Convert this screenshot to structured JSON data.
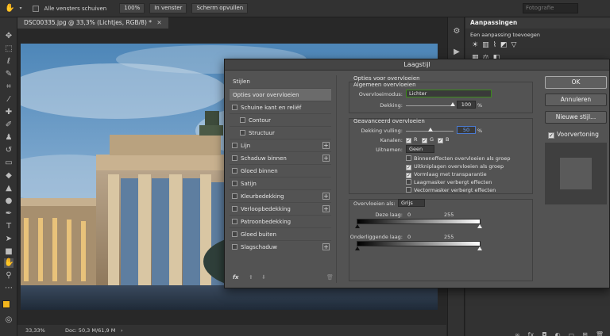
{
  "optbar": {
    "scroll_all": "Alle vensters schuiven",
    "zoom": "100%",
    "fit_window": "In venster",
    "fill_screen": "Scherm opvullen",
    "workspace": "Fotografie"
  },
  "document": {
    "tab": "DSC00335.jpg @ 33,3% (Lichtjes, RGB/8) *",
    "zoom": "33,33%",
    "doc_info": "Doc: 50,3 M/61,9 M"
  },
  "panel": {
    "title": "Aanpassingen",
    "subtitle": "Een aanpassing toevoegen"
  },
  "dialog": {
    "title": "Laagstijl",
    "styles_header": "Stijlen",
    "style_items": [
      {
        "label": "Opties voor overvloeien",
        "selected": true
      },
      {
        "label": "Schuine kant en reliëf",
        "plus": false
      },
      {
        "label": "Contour",
        "sub": true
      },
      {
        "label": "Structuur",
        "sub": true
      },
      {
        "label": "Lijn",
        "plus": true
      },
      {
        "label": "Schaduw binnen",
        "plus": true
      },
      {
        "label": "Gloed binnen"
      },
      {
        "label": "Satijn"
      },
      {
        "label": "Kleurbedekking",
        "plus": true
      },
      {
        "label": "Verloopbedekking",
        "plus": true
      },
      {
        "label": "Patroonbedekking"
      },
      {
        "label": "Gloed buiten"
      },
      {
        "label": "Slagschaduw",
        "plus": true
      }
    ],
    "blend_options": {
      "section": "Opties voor overvloeien",
      "general": "Algemeen overvloeien",
      "mode_label": "Overvloeimodus:",
      "mode_value": "Lichter",
      "opacity_label": "Dekking:",
      "opacity_value": "100",
      "unit": "%",
      "advanced": "Geavanceerd overvloeien",
      "fill_label": "Dekking vulling:",
      "fill_value": "50",
      "channels_label": "Kanalen:",
      "ch_r": "R",
      "ch_g": "G",
      "ch_b": "B",
      "knockout_label": "Uitnemen:",
      "knockout_value": "Geen",
      "options": [
        {
          "label": "Binneneffecten overvloeien als groep",
          "on": false
        },
        {
          "label": "Uitknipla­gen overvloeien als groep",
          "on": true
        },
        {
          "label": "Vormlaag met transparantie",
          "on": true
        },
        {
          "label": "Laagmasker verbergt effecten",
          "on": false
        },
        {
          "label": "Vectormasker verbergt effecten",
          "on": false
        }
      ],
      "blend_if_label": "Overvloeien als:",
      "blend_if_value": "Grijs",
      "this_layer": "Deze laag:",
      "underlying": "Onderliggende laag:",
      "v0": "0",
      "v255": "255"
    },
    "buttons": {
      "ok": "OK",
      "cancel": "Annuleren",
      "new_style": "Nieuwe stijl...",
      "preview": "Voorvertoning"
    }
  }
}
